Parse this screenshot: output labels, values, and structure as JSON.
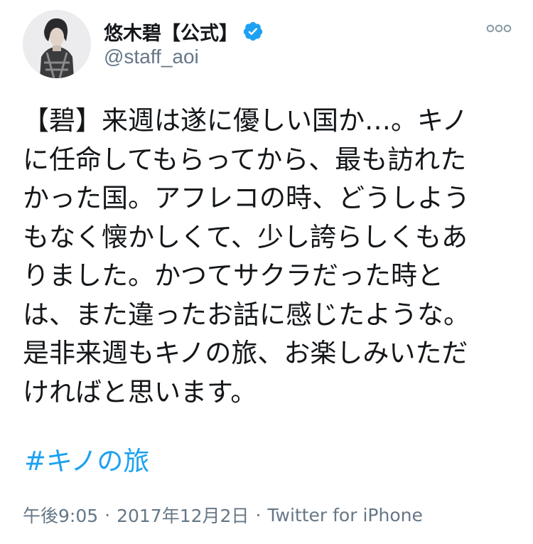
{
  "user": {
    "display_name": "悠木碧【公式】",
    "handle": "@staff_aoi",
    "verified": true,
    "verified_color": "#1da1f2"
  },
  "tweet": {
    "lines": [
      "【碧】来週は遂に優しい国か…。キノ",
      "に任命してもらってから、最も訪れた",
      "かった国。アフレコの時、どうしよう",
      "もなく懐かしくて、少し誇らしくもあ",
      "りました。かつてサクラだった時と",
      "は、また違ったお話に感じたような。",
      "是非来週もキノの旅、お楽しみいただ",
      "ければと思います。"
    ],
    "hashtag": "#キノの旅",
    "time": "午後9:05",
    "date": "2017年12月2日",
    "source": "Twitter for iPhone",
    "separator": "·",
    "hashtag_color": "#1da1f2",
    "meta_color": "#657786"
  },
  "icons": {
    "avatar": "profile-photo",
    "verified": "verified-badge-icon",
    "more": "more-options-icon"
  }
}
